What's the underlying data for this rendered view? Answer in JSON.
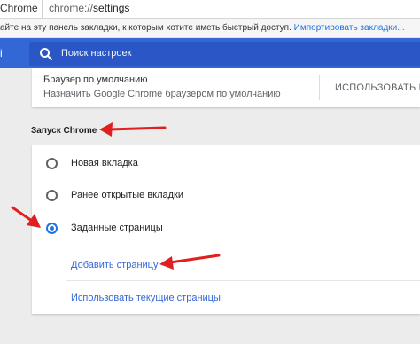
{
  "address_bar": {
    "site": "Chrome",
    "url_scheme": "chrome://",
    "url_path": "settings"
  },
  "bookmarks_bar": {
    "message": "айте на эту панель закладки, к которым хотите иметь быстрый доступ.",
    "import_link": "Импортировать закладки..."
  },
  "header": {
    "search_placeholder": "Поиск настроек"
  },
  "default_browser": {
    "title": "Браузер по умолчанию",
    "subtitle": "Назначить Google Chrome браузером по умолчанию",
    "action": "ИСПОЛЬЗОВАТЬ ПО"
  },
  "startup": {
    "section_title": "Запуск Chrome",
    "options": [
      {
        "label": "Новая вкладка",
        "selected": false
      },
      {
        "label": "Ранее открытые вкладки",
        "selected": false
      },
      {
        "label": "Заданные страницы",
        "selected": true
      }
    ],
    "add_page": "Добавить страницу",
    "use_current": "Использовать текущие страницы"
  },
  "colors": {
    "header_blue": "#3367d6",
    "search_blue": "#2a56c6",
    "link_blue": "#3367d6",
    "annotation_red": "#e02020"
  },
  "icons": {
    "search": "search-icon",
    "annotation": "red-arrow-annotation"
  }
}
